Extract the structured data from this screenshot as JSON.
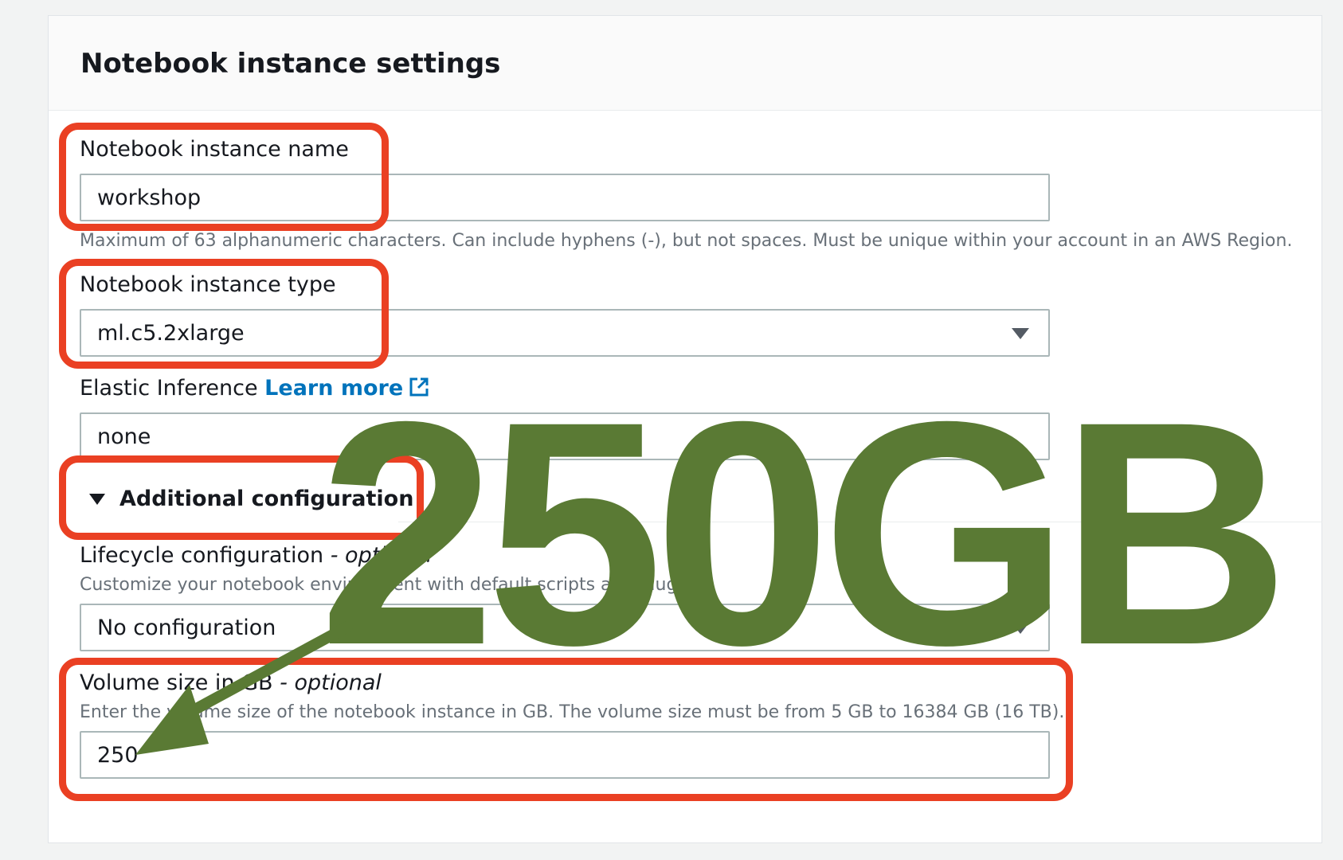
{
  "panel": {
    "title": "Notebook instance settings"
  },
  "fields": {
    "name": {
      "label": "Notebook instance name",
      "value": "workshop",
      "help": "Maximum of 63 alphanumeric characters. Can include hyphens (-), but not spaces. Must be unique within your account in an AWS Region."
    },
    "type": {
      "label": "Notebook instance type",
      "value": "ml.c5.2xlarge"
    },
    "elastic": {
      "label": "Elastic Inference",
      "link": "Learn more",
      "value": "none"
    },
    "additional": {
      "label": "Additional configuration"
    },
    "lifecycle": {
      "label": "Lifecycle configuration",
      "optional": "- optional",
      "help": "Customize your notebook environment with default scripts and plugins.",
      "value": "No configuration"
    },
    "volume": {
      "label": "Volume size in GB",
      "optional": "- optional",
      "help": "Enter the volume size of the notebook instance in GB. The volume size must be from 5 GB to 16384 GB (16 TB).",
      "value": "250"
    }
  },
  "overlay": {
    "text": "250GB",
    "color": "#5a7a34",
    "highlight_color": "#ea4023"
  },
  "icons": {
    "external_link": "external-link-icon",
    "dropdown": "caret-down-icon",
    "expander": "triangle-down-icon"
  }
}
